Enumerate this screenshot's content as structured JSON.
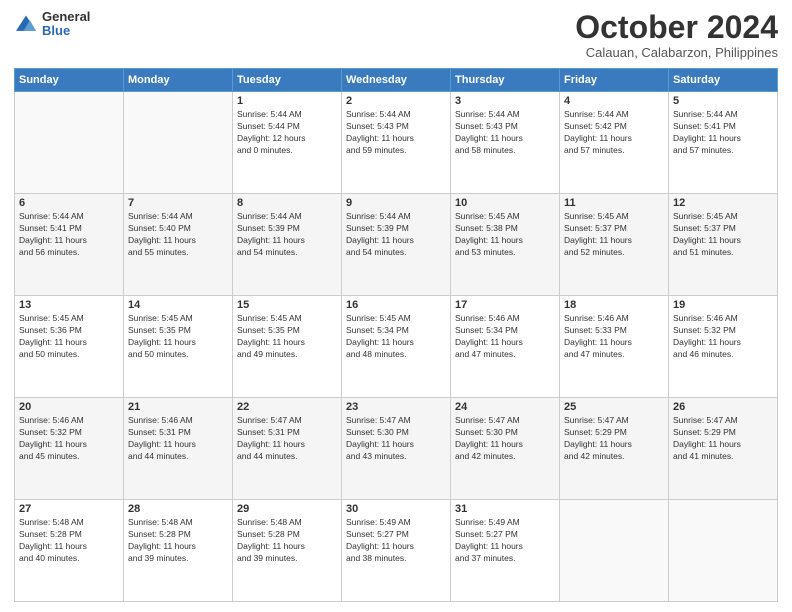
{
  "header": {
    "logo_general": "General",
    "logo_blue": "Blue",
    "month_title": "October 2024",
    "location": "Calauan, Calabarzon, Philippines"
  },
  "days_of_week": [
    "Sunday",
    "Monday",
    "Tuesday",
    "Wednesday",
    "Thursday",
    "Friday",
    "Saturday"
  ],
  "weeks": [
    [
      {
        "day": "",
        "info": ""
      },
      {
        "day": "",
        "info": ""
      },
      {
        "day": "1",
        "info": "Sunrise: 5:44 AM\nSunset: 5:44 PM\nDaylight: 12 hours\nand 0 minutes."
      },
      {
        "day": "2",
        "info": "Sunrise: 5:44 AM\nSunset: 5:43 PM\nDaylight: 11 hours\nand 59 minutes."
      },
      {
        "day": "3",
        "info": "Sunrise: 5:44 AM\nSunset: 5:43 PM\nDaylight: 11 hours\nand 58 minutes."
      },
      {
        "day": "4",
        "info": "Sunrise: 5:44 AM\nSunset: 5:42 PM\nDaylight: 11 hours\nand 57 minutes."
      },
      {
        "day": "5",
        "info": "Sunrise: 5:44 AM\nSunset: 5:41 PM\nDaylight: 11 hours\nand 57 minutes."
      }
    ],
    [
      {
        "day": "6",
        "info": "Sunrise: 5:44 AM\nSunset: 5:41 PM\nDaylight: 11 hours\nand 56 minutes."
      },
      {
        "day": "7",
        "info": "Sunrise: 5:44 AM\nSunset: 5:40 PM\nDaylight: 11 hours\nand 55 minutes."
      },
      {
        "day": "8",
        "info": "Sunrise: 5:44 AM\nSunset: 5:39 PM\nDaylight: 11 hours\nand 54 minutes."
      },
      {
        "day": "9",
        "info": "Sunrise: 5:44 AM\nSunset: 5:39 PM\nDaylight: 11 hours\nand 54 minutes."
      },
      {
        "day": "10",
        "info": "Sunrise: 5:45 AM\nSunset: 5:38 PM\nDaylight: 11 hours\nand 53 minutes."
      },
      {
        "day": "11",
        "info": "Sunrise: 5:45 AM\nSunset: 5:37 PM\nDaylight: 11 hours\nand 52 minutes."
      },
      {
        "day": "12",
        "info": "Sunrise: 5:45 AM\nSunset: 5:37 PM\nDaylight: 11 hours\nand 51 minutes."
      }
    ],
    [
      {
        "day": "13",
        "info": "Sunrise: 5:45 AM\nSunset: 5:36 PM\nDaylight: 11 hours\nand 50 minutes."
      },
      {
        "day": "14",
        "info": "Sunrise: 5:45 AM\nSunset: 5:35 PM\nDaylight: 11 hours\nand 50 minutes."
      },
      {
        "day": "15",
        "info": "Sunrise: 5:45 AM\nSunset: 5:35 PM\nDaylight: 11 hours\nand 49 minutes."
      },
      {
        "day": "16",
        "info": "Sunrise: 5:45 AM\nSunset: 5:34 PM\nDaylight: 11 hours\nand 48 minutes."
      },
      {
        "day": "17",
        "info": "Sunrise: 5:46 AM\nSunset: 5:34 PM\nDaylight: 11 hours\nand 47 minutes."
      },
      {
        "day": "18",
        "info": "Sunrise: 5:46 AM\nSunset: 5:33 PM\nDaylight: 11 hours\nand 47 minutes."
      },
      {
        "day": "19",
        "info": "Sunrise: 5:46 AM\nSunset: 5:32 PM\nDaylight: 11 hours\nand 46 minutes."
      }
    ],
    [
      {
        "day": "20",
        "info": "Sunrise: 5:46 AM\nSunset: 5:32 PM\nDaylight: 11 hours\nand 45 minutes."
      },
      {
        "day": "21",
        "info": "Sunrise: 5:46 AM\nSunset: 5:31 PM\nDaylight: 11 hours\nand 44 minutes."
      },
      {
        "day": "22",
        "info": "Sunrise: 5:47 AM\nSunset: 5:31 PM\nDaylight: 11 hours\nand 44 minutes."
      },
      {
        "day": "23",
        "info": "Sunrise: 5:47 AM\nSunset: 5:30 PM\nDaylight: 11 hours\nand 43 minutes."
      },
      {
        "day": "24",
        "info": "Sunrise: 5:47 AM\nSunset: 5:30 PM\nDaylight: 11 hours\nand 42 minutes."
      },
      {
        "day": "25",
        "info": "Sunrise: 5:47 AM\nSunset: 5:29 PM\nDaylight: 11 hours\nand 42 minutes."
      },
      {
        "day": "26",
        "info": "Sunrise: 5:47 AM\nSunset: 5:29 PM\nDaylight: 11 hours\nand 41 minutes."
      }
    ],
    [
      {
        "day": "27",
        "info": "Sunrise: 5:48 AM\nSunset: 5:28 PM\nDaylight: 11 hours\nand 40 minutes."
      },
      {
        "day": "28",
        "info": "Sunrise: 5:48 AM\nSunset: 5:28 PM\nDaylight: 11 hours\nand 39 minutes."
      },
      {
        "day": "29",
        "info": "Sunrise: 5:48 AM\nSunset: 5:28 PM\nDaylight: 11 hours\nand 39 minutes."
      },
      {
        "day": "30",
        "info": "Sunrise: 5:49 AM\nSunset: 5:27 PM\nDaylight: 11 hours\nand 38 minutes."
      },
      {
        "day": "31",
        "info": "Sunrise: 5:49 AM\nSunset: 5:27 PM\nDaylight: 11 hours\nand 37 minutes."
      },
      {
        "day": "",
        "info": ""
      },
      {
        "day": "",
        "info": ""
      }
    ]
  ]
}
